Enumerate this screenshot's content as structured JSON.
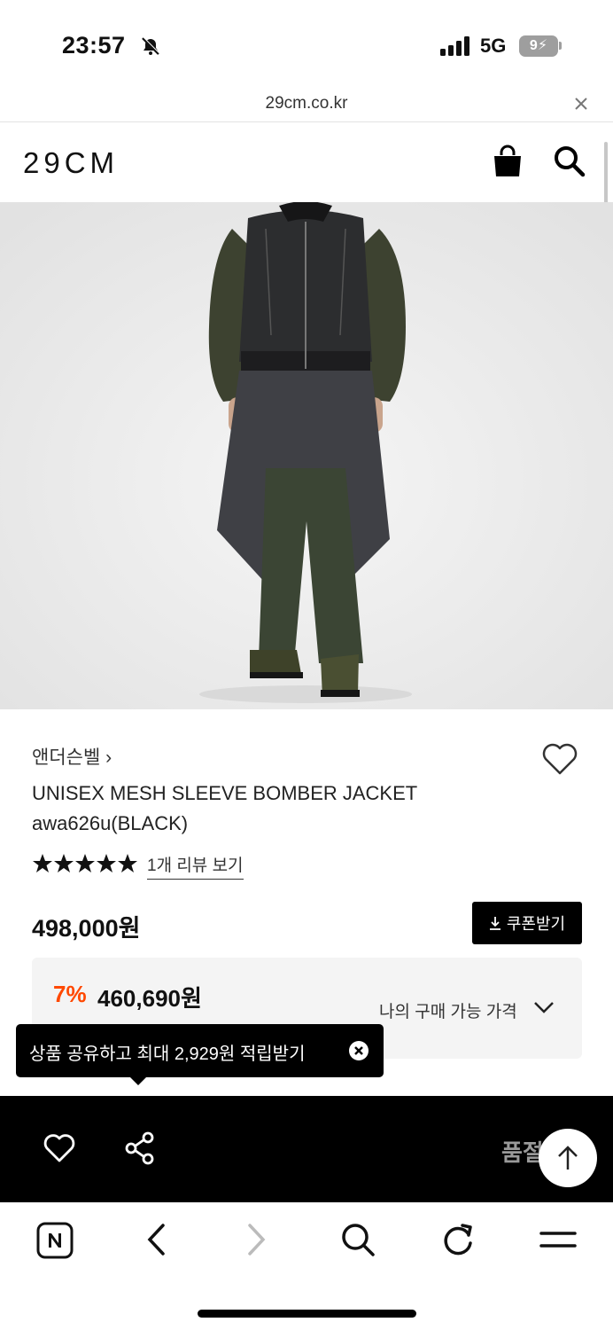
{
  "status_bar": {
    "time": "23:57",
    "network": "5G",
    "battery": "9"
  },
  "browser": {
    "url": "29cm.co.kr"
  },
  "site": {
    "logo": "29CM"
  },
  "product": {
    "brand": "앤더슨벨 ›",
    "title": "UNISEX MESH SLEEVE BOMBER JACKET awa626u(BLACK)",
    "rating_stars": 5,
    "review_link": "1개 리뷰 보기",
    "price": "498,000원",
    "coupon_button": "쿠폰받기",
    "discount_rate": "7%",
    "discount_price": "460,690원",
    "my_price_label": "나의 구매 가능 가격"
  },
  "tooltip": {
    "text": "상품 공유하고 최대 2,929원 적립받기"
  },
  "action_bar": {
    "partial_text": "품절"
  },
  "icons": {
    "cart": "cart-icon",
    "search": "search-icon",
    "wish": "heart-icon",
    "share": "share-icon",
    "scroll_top": "arrow-up-icon",
    "naver": "naver-home-icon",
    "back": "back-icon",
    "forward": "forward-icon",
    "reload": "reload-icon",
    "menu": "menu-icon"
  },
  "colors": {
    "discount": "#ff4800",
    "action_bar": "#000000",
    "tooltip_bg": "#000000"
  }
}
